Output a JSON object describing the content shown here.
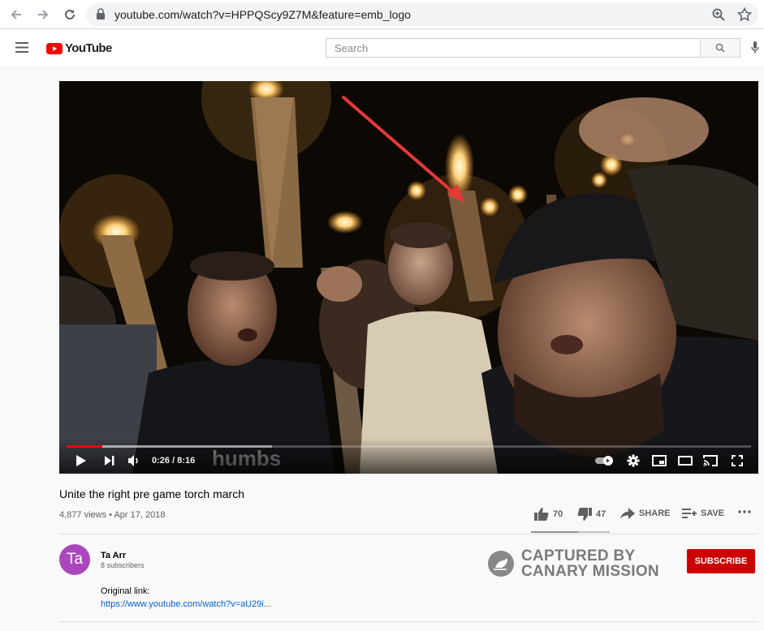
{
  "browser": {
    "url": "youtube.com/watch?v=HPPQScy9Z7M&feature=emb_logo",
    "icons": [
      "back-icon",
      "forward-icon",
      "reload-icon",
      "lock-icon",
      "zoom-icon",
      "bookmark-star-icon"
    ]
  },
  "header": {
    "logo_text": "YouTube",
    "search_placeholder": "Search",
    "icons": [
      "menu-icon",
      "search-icon",
      "mic-icon"
    ]
  },
  "player": {
    "current_time": "0:26",
    "duration": "8:16",
    "time_display": "0:26 / 8:16",
    "played_fraction": 0.052,
    "buffered_fraction": 0.3,
    "icons": [
      "play-icon",
      "next-icon",
      "volume-icon",
      "autoplay-toggle-icon",
      "settings-icon",
      "miniplayer-icon",
      "theater-icon",
      "cast-icon",
      "fullscreen-icon"
    ],
    "scene_text": "humbs"
  },
  "video": {
    "title": "Unite the right pre game torch march",
    "meta": "4,877 views • Apr 17, 2018",
    "likes": "70",
    "dislikes": "47",
    "like_ratio": 0.6,
    "share_label": "SHARE",
    "save_label": "SAVE"
  },
  "channel": {
    "avatar_text": "Ta",
    "avatar_color": "#ab47bc",
    "name": "Ta Arr",
    "subscribers": "8 subscribers",
    "subscribe_label": "SUBSCRIBE",
    "subscribe_color": "#cc0000"
  },
  "description": {
    "line1": "Original link:",
    "link": "https://www.youtube.com/watch?v=aU29i..."
  },
  "watermark": {
    "line1": "CAPTURED BY",
    "line2": "CANARY MISSION"
  }
}
